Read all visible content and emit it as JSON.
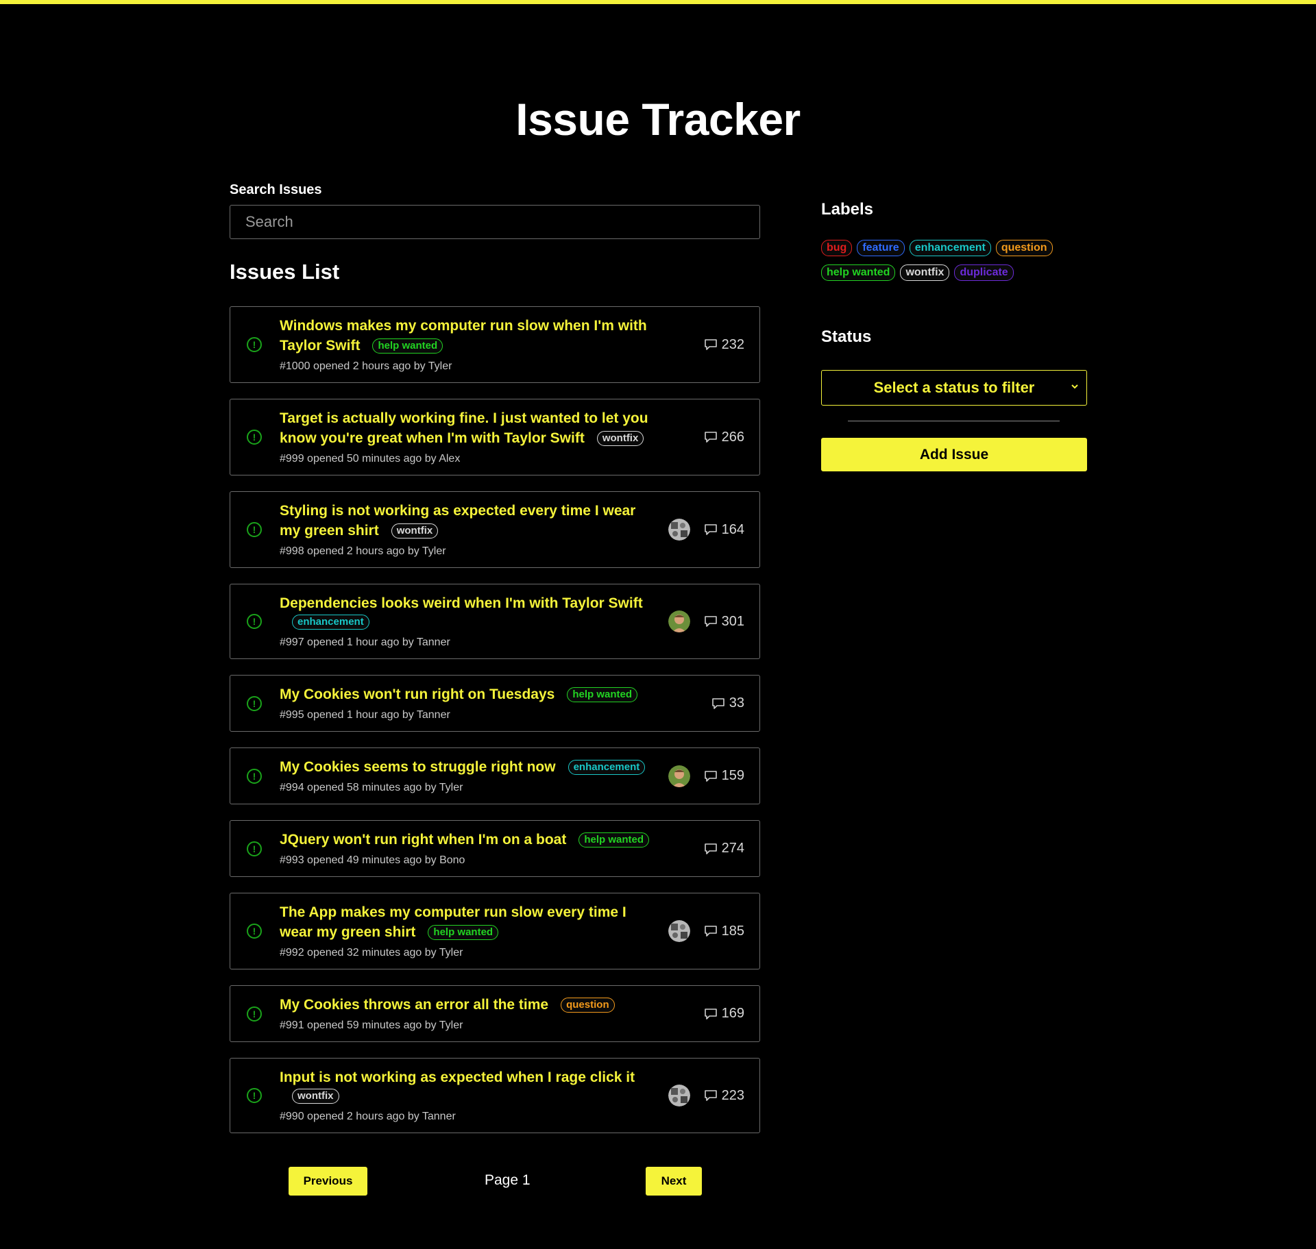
{
  "app": {
    "title": "Issue Tracker",
    "accent": "#f5f33a"
  },
  "search": {
    "label": "Search Issues",
    "placeholder": "Search",
    "value": ""
  },
  "list": {
    "title": "Issues List"
  },
  "label_colors": {
    "bug": "#e11d1d",
    "feature": "#2f6bff",
    "enhancement": "#19c7c7",
    "question": "#f39a1b",
    "help wanted": "#22d322",
    "wontfix": "#d8d8d8",
    "duplicate": "#6c2bd9"
  },
  "issues": [
    {
      "title": "Windows makes my computer run slow when I'm with Taylor Swift",
      "label": "help wanted",
      "meta": "#1000 opened 2 hours ago by Tyler",
      "comments": "232",
      "avatar": null
    },
    {
      "title": "Target is actually working fine. I just wanted to let you know you're great when I'm with Taylor Swift",
      "label": "wontfix",
      "meta": "#999 opened 50 minutes ago by Alex",
      "comments": "266",
      "avatar": null
    },
    {
      "title": "Styling is not working as expected every time I wear my green shirt",
      "label": "wontfix",
      "meta": "#998 opened 2 hours ago by Tyler",
      "comments": "164",
      "avatar": "gray"
    },
    {
      "title": "Dependencies looks weird when I'm with Taylor Swift",
      "label": "enhancement",
      "meta": "#997 opened 1 hour ago by Tanner",
      "comments": "301",
      "avatar": "color"
    },
    {
      "title": "My Cookies won't run right on Tuesdays",
      "label": "help wanted",
      "meta": "#995 opened 1 hour ago by Tanner",
      "comments": "33",
      "avatar": null
    },
    {
      "title": "My Cookies seems to struggle right now",
      "label": "enhancement",
      "meta": "#994 opened 58 minutes ago by Tyler",
      "comments": "159",
      "avatar": "color"
    },
    {
      "title": "JQuery won't run right when I'm on a boat",
      "label": "help wanted",
      "meta": "#993 opened 49 minutes ago by Bono",
      "comments": "274",
      "avatar": null
    },
    {
      "title": "The App makes my computer run slow every time I wear my green shirt",
      "label": "help wanted",
      "meta": "#992 opened 32 minutes ago by Tyler",
      "comments": "185",
      "avatar": "gray"
    },
    {
      "title": "My Cookies throws an error all the time",
      "label": "question",
      "meta": "#991 opened 59 minutes ago by Tyler",
      "comments": "169",
      "avatar": null
    },
    {
      "title": "Input is not working as expected when I rage click it",
      "label": "wontfix",
      "meta": "#990 opened 2 hours ago by Tanner",
      "comments": "223",
      "avatar": "gray"
    }
  ],
  "pagination": {
    "previous_label": "Previous",
    "page_label": "Page 1",
    "next_label": "Next"
  },
  "sidebar": {
    "labels_heading": "Labels",
    "labels": [
      "bug",
      "feature",
      "enhancement",
      "question",
      "help wanted",
      "wontfix",
      "duplicate"
    ],
    "status_heading": "Status",
    "status_select_value": "Select a status to filter",
    "add_issue_label": "Add Issue"
  }
}
